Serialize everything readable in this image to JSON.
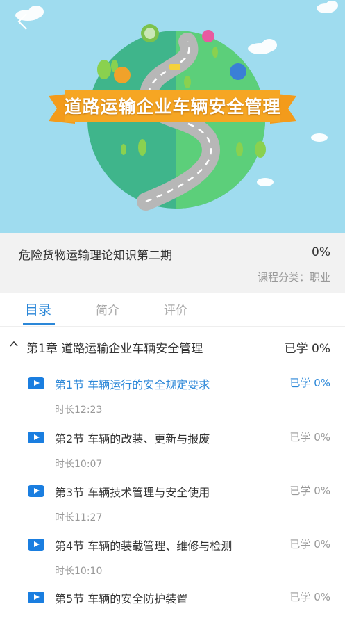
{
  "banner": {
    "title": "道路运输企业车辆安全管理"
  },
  "course": {
    "title": "危险货物运输理论知识第二期",
    "progress": "0%",
    "category": "课程分类：职业"
  },
  "tabs": [
    {
      "label": "目录",
      "active": true
    },
    {
      "label": "简介",
      "active": false
    },
    {
      "label": "评价",
      "active": false
    }
  ],
  "chapter": {
    "title": "第1章 道路运输企业车辆安全管理",
    "status": "已学 0%",
    "expand_icon": "chevron-up-icon"
  },
  "sections": [
    {
      "title": "第1节 车辆运行的安全规定要求",
      "status": "已学 0%",
      "duration": "时长12:23",
      "active": true
    },
    {
      "title": "第2节 车辆的改装、更新与报废",
      "status": "已学 0%",
      "duration": "时长10:07",
      "active": false
    },
    {
      "title": "第3节 车辆技术管理与安全使用",
      "status": "已学 0%",
      "duration": "时长11:27",
      "active": false
    },
    {
      "title": "第4节 车辆的装载管理、维修与检测",
      "status": "已学 0%",
      "duration": "时长10:10",
      "active": false
    },
    {
      "title": "第5节 车辆的安全防护装置",
      "status": "已学 0%",
      "duration": "",
      "active": false
    }
  ],
  "colors": {
    "accent": "#2b87d8",
    "banner_sky": "#9fdcef",
    "globe": "#4fbf7f",
    "ribbon": "#f6a623"
  }
}
